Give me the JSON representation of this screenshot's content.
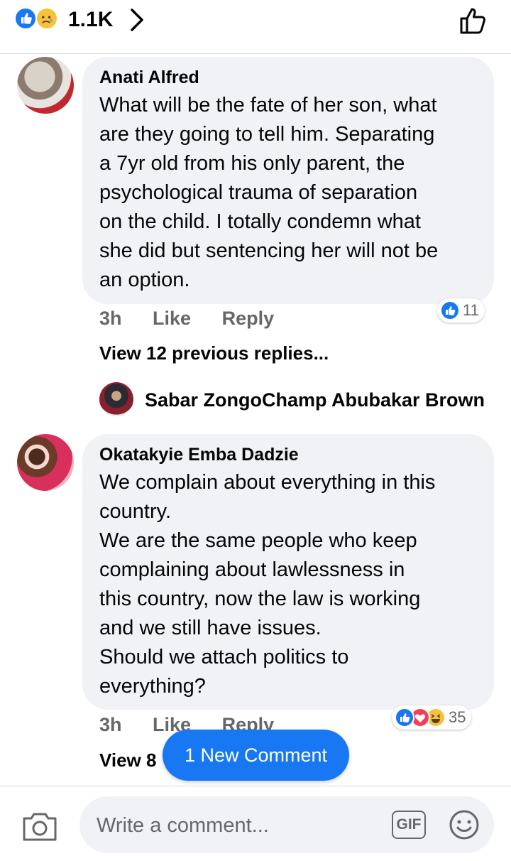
{
  "header": {
    "reaction_count": "1.1K",
    "reaction_icons": [
      "like-icon",
      "sad-icon"
    ],
    "chevron_icon": "chevron-right-icon",
    "like_button_icon": "thumbs-up-outline-icon"
  },
  "comments": [
    {
      "author": "Anati Alfred",
      "lines": [
        "What will be the fate of her son, what",
        "are they going to tell him. Separating",
        "a 7yr old from his only parent, the",
        "psychological trauma of separation",
        "on the child. I totally condemn what",
        "she did but sentencing her will not be",
        "an option."
      ],
      "time": "3h",
      "like_label": "Like",
      "reply_label": "Reply",
      "reaction_count": "11",
      "reactions": [
        "like-icon"
      ],
      "view_replies": "View 12 previous replies...",
      "latest_reply_name": "Sabar ZongoChamp Abubakar Brown"
    },
    {
      "author": "Okatakyie Emba Dadzie",
      "lines": [
        "We complain about everything in this",
        "country.",
        "We are the same people who keep",
        "complaining about lawlessness in",
        "this country, now the law is working",
        "and we still have issues.",
        "Should we attach politics to",
        "everything?"
      ],
      "time": "3h",
      "like_label": "Like",
      "reply_label": "Reply",
      "reaction_count": "35",
      "reactions": [
        "like-icon",
        "love-icon",
        "haha-icon"
      ],
      "view_replies": "View 8"
    }
  ],
  "new_comment_label": "1 New Comment",
  "composer": {
    "placeholder": "Write a comment...",
    "gif_label": "GIF",
    "icons": [
      "camera-icon",
      "gif-icon",
      "emoji-icon"
    ]
  },
  "colors": {
    "accent": "#1877f2",
    "bubble": "#f0f2f5",
    "secondary_text": "#65676b",
    "love": "#f33e58",
    "haha": "#f7c13a"
  }
}
